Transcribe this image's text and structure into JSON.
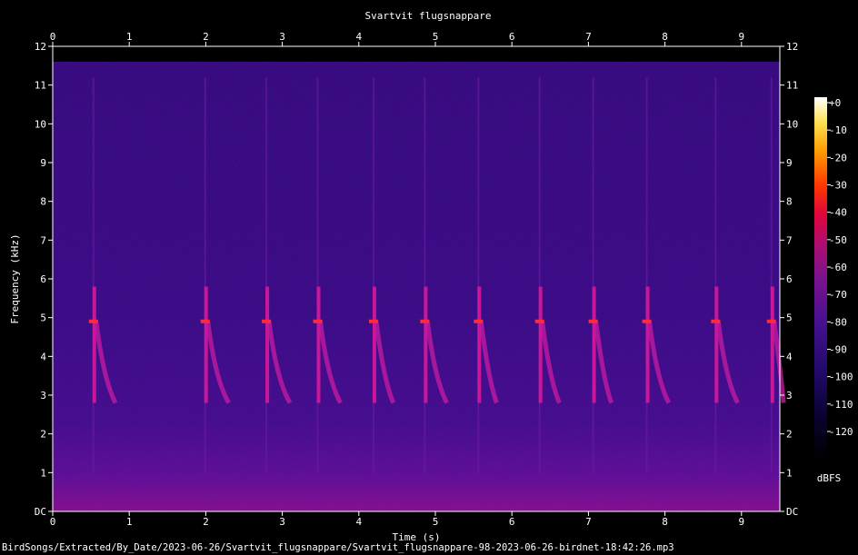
{
  "chart_data": {
    "type": "heatmap",
    "title": "Svartvit flugsnappare",
    "xlabel": "Time (s)",
    "ylabel": "Frequency (kHz)",
    "xlim": [
      0,
      9.55
    ],
    "ylim": [
      0,
      12
    ],
    "x_ticks": [
      "0",
      "1",
      "2",
      "3",
      "4",
      "5",
      "6",
      "7",
      "8",
      "9"
    ],
    "y_ticks": [
      "DC",
      "1",
      "2",
      "3",
      "4",
      "5",
      "6",
      "7",
      "8",
      "9",
      "10",
      "11",
      "12"
    ],
    "colorbar": {
      "label": "dBFS",
      "range": [
        -120,
        0
      ],
      "ticks": [
        "+0",
        "-10",
        "-20",
        "-30",
        "-40",
        "-50",
        "-60",
        "-70",
        "-80",
        "-90",
        "-100",
        "-110",
        "-120"
      ]
    },
    "calls": [
      {
        "start": 0.52,
        "end": 0.82,
        "low_khz": 2.8,
        "high_khz": 5.8
      },
      {
        "start": 1.98,
        "end": 2.3,
        "low_khz": 2.8,
        "high_khz": 5.8
      },
      {
        "start": 2.78,
        "end": 3.1,
        "low_khz": 2.8,
        "high_khz": 5.8
      },
      {
        "start": 3.45,
        "end": 3.76,
        "low_khz": 2.8,
        "high_khz": 5.8
      },
      {
        "start": 4.18,
        "end": 4.45,
        "low_khz": 2.8,
        "high_khz": 5.8
      },
      {
        "start": 4.85,
        "end": 5.15,
        "low_khz": 2.8,
        "high_khz": 5.8
      },
      {
        "start": 5.55,
        "end": 5.8,
        "low_khz": 2.8,
        "high_khz": 5.8
      },
      {
        "start": 6.35,
        "end": 6.62,
        "low_khz": 2.8,
        "high_khz": 5.8
      },
      {
        "start": 7.05,
        "end": 7.3,
        "low_khz": 2.8,
        "high_khz": 5.8
      },
      {
        "start": 7.75,
        "end": 8.05,
        "low_khz": 2.8,
        "high_khz": 5.8
      },
      {
        "start": 8.65,
        "end": 8.95,
        "low_khz": 2.8,
        "high_khz": 5.8
      },
      {
        "start": 9.38,
        "end": 9.55,
        "low_khz": 2.8,
        "high_khz": 5.8
      }
    ]
  },
  "footer": {
    "filepath": "BirdSongs/Extracted/By_Date/2023-06-26/Svartvit_flugsnappare/Svartvit_flugsnappare-98-2023-06-26-birdnet-18:42:26.mp3"
  }
}
